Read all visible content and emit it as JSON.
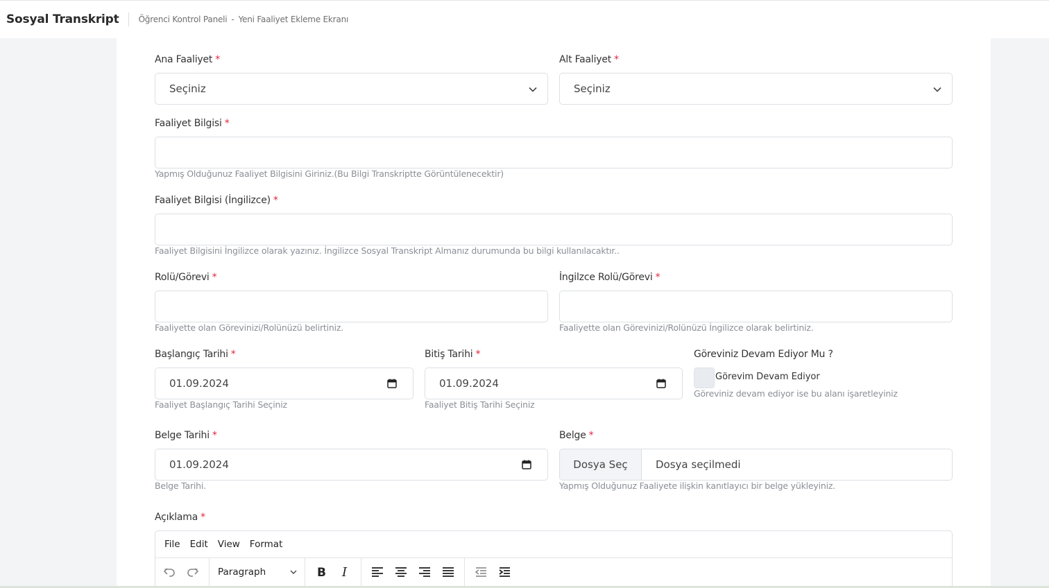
{
  "header": {
    "brand": "Sosyal Transkript",
    "breadcrumb": {
      "item1": "Öğrenci Kontrol Paneli",
      "separator": "-",
      "item2": "Yeni Faaliyet Ekleme Ekranı"
    }
  },
  "form": {
    "ana_faaliyet": {
      "label": "Ana Faaliyet",
      "required": "*",
      "value": "Seçiniz"
    },
    "alt_faaliyet": {
      "label": "Alt Faaliyet",
      "required": "*",
      "value": "Seçiniz"
    },
    "faaliyet_bilgisi": {
      "label": "Faaliyet Bilgisi",
      "required": "*",
      "value": "",
      "help": "Yapmış Olduğunuz Faaliyet Bilgisini Giriniz.(Bu Bilgi Transkriptte Görüntülenecektir)"
    },
    "faaliyet_bilgisi_en": {
      "label": "Faaliyet Bilgisi (İngilizce)",
      "required": "*",
      "value": "",
      "help": "Faaliyet Bilgisini İngilizce olarak yazınız. İngilizce Sosyal Transkript Almanız durumunda bu bilgi kullanılacaktır.."
    },
    "rol": {
      "label": "Rolü/Görevi",
      "required": "*",
      "value": "",
      "help": "Faaliyette olan Görevinizi/Rolünüzü belirtiniz."
    },
    "rol_en": {
      "label": "İngilzce Rolü/Görevi",
      "required": "*",
      "value": "",
      "help": "Faaliyette olan Görevinizi/Rolünüzü İngilizce olarak belirtiniz."
    },
    "baslangic": {
      "label": "Başlangıç Tarihi",
      "required": "*",
      "value": "01.09.2024",
      "help": "Faaliyet Başlangıç Tarihi Seçiniz"
    },
    "bitis": {
      "label": "Bitiş Tarihi",
      "required": "*",
      "value": "01.09.2024",
      "help": "Faaliyet Bitiş Tarihi Seçiniz"
    },
    "devam": {
      "label": "Göreviniz Devam Ediyor Mu ?",
      "checkbox_label": "Görevim Devam Ediyor",
      "checked": false,
      "help": "Göreviniz devam ediyor ise bu alanı işaretleyiniz"
    },
    "belge_tarihi": {
      "label": "Belge Tarihi",
      "required": "*",
      "value": "01.09.2024",
      "help": "Belge Tarihi."
    },
    "belge": {
      "label": "Belge",
      "required": "*",
      "button": "Dosya Seç",
      "status": "Dosya seçilmedi",
      "help": "Yapmış Olduğunuz Faaliyete ilişkin kanıtlayıcı bir belge yükleyiniz."
    },
    "aciklama": {
      "label": "Açıklama",
      "required": "*"
    }
  },
  "editor": {
    "menu": [
      "File",
      "Edit",
      "View",
      "Format"
    ],
    "block_format": "Paragraph",
    "icons": [
      "undo-icon",
      "redo-icon",
      "bold-icon",
      "italic-icon",
      "align-left-icon",
      "align-center-icon",
      "align-right-icon",
      "align-justify-icon",
      "outdent-icon",
      "indent-icon"
    ]
  }
}
